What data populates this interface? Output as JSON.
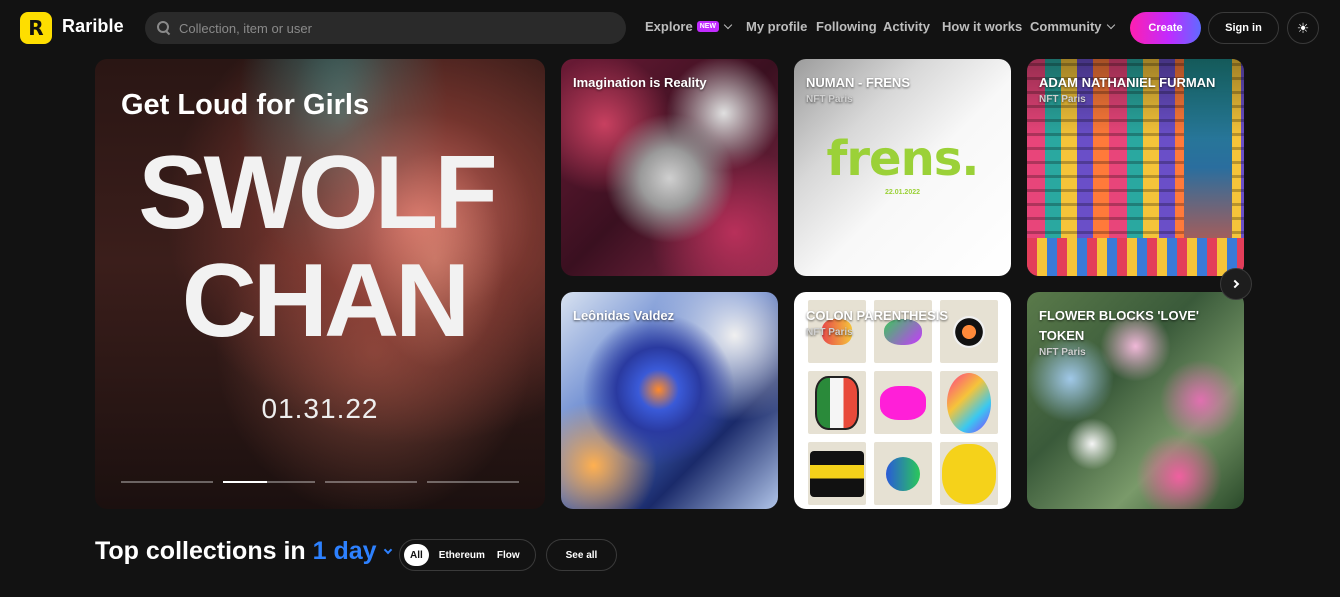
{
  "brand": {
    "name": "Rarible",
    "logo_letter": "R",
    "logo_color": "#fede00"
  },
  "search": {
    "placeholder": "Collection, item or user",
    "value": ""
  },
  "nav": {
    "explore": "Explore",
    "explore_badge": "NEW",
    "my_profile": "My profile",
    "following": "Following",
    "activity": "Activity",
    "how_it_works": "How it works",
    "community": "Community"
  },
  "actions": {
    "create": "Create",
    "sign_in": "Sign in",
    "theme_icon": "sun-icon"
  },
  "hero": {
    "title": "Get Loud for Girls",
    "line1": "SWOLF",
    "line2": "CHAN",
    "date": "01.31.22",
    "slides": 4,
    "active_slide": 2
  },
  "cards": [
    {
      "title": "Imagination is Reality",
      "subtitle": ""
    },
    {
      "title": "NUMAN - FRENS",
      "subtitle": "NFT Paris",
      "art_text": "frens.",
      "art_date": "22.01.2022",
      "accent": "#9bd138"
    },
    {
      "title": "ADAM NATHANIEL FURMAN",
      "subtitle": "NFT Paris"
    },
    {
      "title": "Leônidas Valdez",
      "subtitle": ""
    },
    {
      "title": "COLON PARENTHESIS",
      "subtitle": "NFT Paris"
    },
    {
      "title": "FLOWER BLOCKS 'LOVE' TOKEN",
      "subtitle": "NFT Paris"
    }
  ],
  "top_collections": {
    "title_prefix": "Top collections in",
    "period": "1 day",
    "period_color": "#2d81ff",
    "filters": [
      "All",
      "Ethereum",
      "Flow"
    ],
    "active_filter": "All",
    "see_all": "See all"
  }
}
